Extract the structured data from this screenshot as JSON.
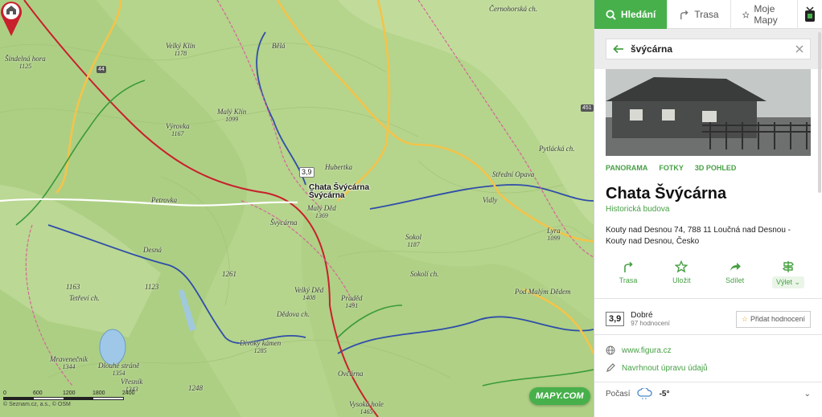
{
  "panel": {
    "tabs": [
      {
        "label": "Hledání",
        "icon": "search-icon",
        "active": true
      },
      {
        "label": "Trasa",
        "icon": "route-icon",
        "active": false
      },
      {
        "label": "Moje Mapy",
        "icon": "star-icon",
        "active": false
      }
    ],
    "search": {
      "value": "švýcárna",
      "placeholder": ""
    },
    "media_tabs": [
      "PANORAMA",
      "FOTKY",
      "3D POHLED"
    ],
    "poi": {
      "title": "Chata Švýcárna",
      "category": "Historická budova",
      "address_line1": "Kouty nad Desnou 74, 788 11 Loučná nad Desnou -",
      "address_line2": "Kouty nad Desnou, Česko"
    },
    "actions": [
      {
        "label": "Trasa",
        "icon": "route-icon"
      },
      {
        "label": "Uložit",
        "icon": "star-icon"
      },
      {
        "label": "Sdílet",
        "icon": "share-icon"
      },
      {
        "label": "Výlet",
        "icon": "signpost-icon"
      }
    ],
    "rating": {
      "score": "3,9",
      "label": "Dobré",
      "count": "97 hodnocení",
      "add_label": "Přidat hodnocení"
    },
    "website": "www.figura.cz",
    "suggest_edit": "Navrhnout úpravu údajů",
    "weather": {
      "label": "Počasí",
      "temp": "-5°"
    }
  },
  "map": {
    "marker": {
      "rating": "3,9",
      "name_line1": "Chata Švýcárna",
      "name_line2": "Švýcárna"
    },
    "logo": "MAPY.COM",
    "scale": {
      "ticks": [
        "0",
        "600",
        "1200",
        "1800",
        "2400"
      ],
      "copyright": "© Seznam.cz, a.s., © OSM"
    },
    "labels": [
      {
        "text": "Šindelná hora",
        "elev": "1125"
      },
      {
        "text": "Velký Klín",
        "elev": "1178"
      },
      {
        "text": "Malý Klín",
        "elev": "1099"
      },
      {
        "text": "Výrovka",
        "elev": "1167"
      },
      {
        "text": "Bělá",
        "elev": ""
      },
      {
        "text": "Černohorská ch.",
        "elev": ""
      },
      {
        "text": "Hubertka",
        "elev": ""
      },
      {
        "text": "Malý Děd",
        "elev": "1369"
      },
      {
        "text": "Švýcárna",
        "elev": ""
      },
      {
        "text": "Petrovka",
        "elev": ""
      },
      {
        "text": "Vidly",
        "elev": ""
      },
      {
        "text": "Sokol",
        "elev": "1187"
      },
      {
        "text": "Lyra",
        "elev": "1099"
      },
      {
        "text": "Sokolí ch.",
        "elev": ""
      },
      {
        "text": "Velký Děd",
        "elev": "1408"
      },
      {
        "text": "Dědova ch.",
        "elev": ""
      },
      {
        "text": "Praděd",
        "elev": "1491"
      },
      {
        "text": "Divoký kámen",
        "elev": "1285"
      },
      {
        "text": "Ovčárna",
        "elev": ""
      },
      {
        "text": "Vysoká hole",
        "elev": "1465"
      },
      {
        "text": "Mravenečník",
        "elev": "1344"
      },
      {
        "text": "Dlouhé stráně",
        "elev": "1354"
      },
      {
        "text": "Vřesník",
        "elev": "1343"
      },
      {
        "text": "Tetřeví ch.",
        "elev": ""
      },
      {
        "text": "Pytlácká ch.",
        "elev": ""
      },
      {
        "text": "Střední Opava",
        "elev": ""
      },
      {
        "text": "Desná",
        "elev": ""
      },
      {
        "text": "Pod Malým Dědem",
        "elev": ""
      }
    ],
    "numbers": [
      "1163",
      "1123",
      "1261",
      "1248",
      "44",
      "451"
    ]
  },
  "colors": {
    "accent": "#47b04b",
    "link": "#47a044",
    "map_bg": "#b9d58f"
  }
}
